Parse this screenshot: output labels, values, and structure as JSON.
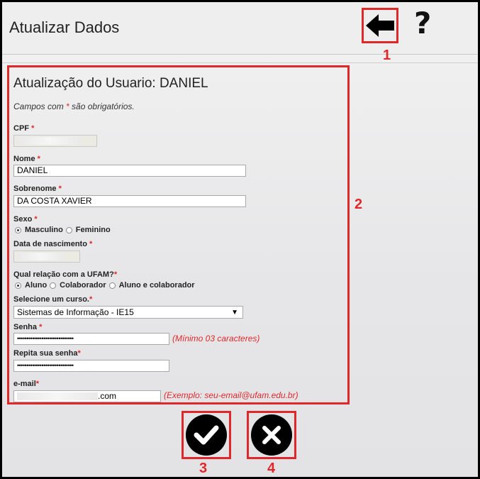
{
  "header": {
    "title": "Atualizar Dados",
    "help_glyph": "?"
  },
  "callouts": {
    "back": "1",
    "form": "2",
    "confirm": "3",
    "cancel": "4"
  },
  "form": {
    "title": "Atualização do Usuario: DANIEL",
    "note_prefix": "Campos com ",
    "note_star": "*",
    "note_suffix": " são obrigatórios.",
    "cpf": {
      "label": "CPF",
      "value": ""
    },
    "nome": {
      "label": "Nome",
      "value": "DANIEL"
    },
    "sobrenome": {
      "label": "Sobrenome",
      "value": "DA COSTA XAVIER"
    },
    "sexo": {
      "label": "Sexo",
      "options": [
        "Masculino",
        "Feminino"
      ],
      "selected": "Masculino"
    },
    "nascimento": {
      "label": "Data de nascimento",
      "value": ""
    },
    "relacao": {
      "label": "Qual relação com a UFAM?",
      "options": [
        "Aluno",
        "Colaborador",
        "Aluno e colaborador"
      ],
      "selected": "Aluno"
    },
    "curso": {
      "label": "Selecione um curso.",
      "value": "Sistemas de Informação - IE15"
    },
    "senha": {
      "label": "Senha",
      "value": "••••••••••••••••••••••••••••••",
      "hint": "(Mínimo 03 caracteres)"
    },
    "repita_senha": {
      "label": "Repita sua senha",
      "value": "••••••••••••••••••••••••••••••"
    },
    "email": {
      "label": "e-mail",
      "value_visible": ".com",
      "hint": "(Exemplo: seu-email@ufam.edu.br)"
    },
    "required_star": "*"
  },
  "colors": {
    "accent_red": "#e0282a",
    "required": "#e0282a"
  },
  "icons": {
    "back": "arrow-left-icon",
    "help": "question-mark-icon",
    "confirm": "checkmark-icon",
    "cancel": "x-icon"
  }
}
